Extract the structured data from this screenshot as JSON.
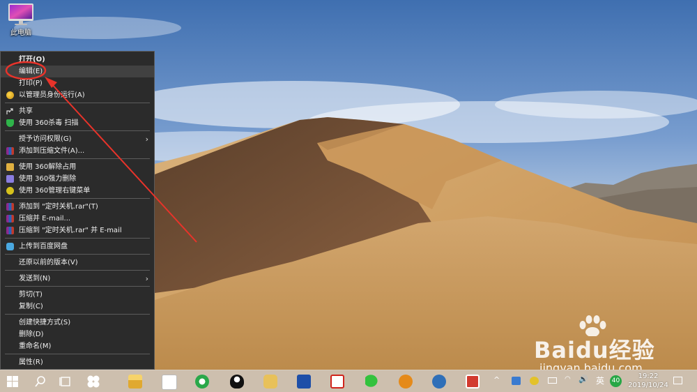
{
  "desktop": {
    "icons": [
      {
        "label": "此电脑",
        "icon": "computer-monitor-icon"
      }
    ]
  },
  "context_menu": {
    "items": [
      {
        "label": "打开(O)",
        "bold": true
      },
      {
        "label": "编辑(E)",
        "highlighted": true
      },
      {
        "label": "打印(P)"
      },
      {
        "label": "以管理员身份运行(A)",
        "icon": "run-as-admin-icon"
      },
      {
        "label": "共享",
        "icon": "share-icon"
      },
      {
        "label": "使用 360杀毒 扫描",
        "icon": "360-shield-icon"
      },
      {
        "label": "授予访问权限(G)",
        "submenu": true
      },
      {
        "label": "添加到压缩文件(A)...",
        "icon": "winrar-icon"
      },
      {
        "label": "使用 360解除占用",
        "icon": "360-unlock-icon"
      },
      {
        "label": "使用 360强力删除",
        "icon": "360-delete-icon"
      },
      {
        "label": "使用 360管理右键菜单",
        "icon": "360-menu-icon"
      },
      {
        "label": "添加到 \"定时关机.rar\"(T)",
        "icon": "winrar-icon"
      },
      {
        "label": "压缩并 E-mail...",
        "icon": "winrar-icon"
      },
      {
        "label": "压缩到 \"定时关机.rar\" 并 E-mail",
        "icon": "winrar-icon"
      },
      {
        "label": "上传到百度网盘",
        "icon": "baidu-netdisk-icon"
      },
      {
        "label": "还原以前的版本(V)"
      },
      {
        "label": "发送到(N)",
        "submenu": true
      },
      {
        "label": "剪切(T)"
      },
      {
        "label": "复制(C)"
      },
      {
        "label": "创建快捷方式(S)"
      },
      {
        "label": "删除(D)"
      },
      {
        "label": "重命名(M)"
      },
      {
        "label": "属性(R)"
      }
    ],
    "submenu_arrow": "›"
  },
  "watermark": {
    "brand": "Baidu经验",
    "url": "jingyan.baidu.com"
  },
  "taskbar": {
    "apps": [
      "start-icon",
      "search-icon",
      "task-view-icon",
      "pinwheel-icon",
      "file-explorer-icon",
      "store-icon",
      "ie-browser-icon",
      "qq-icon",
      "yuanbao-icon",
      "app-icon-tools",
      "app-icon-red",
      "wechat-icon",
      "keyhole-icon",
      "avatar-app-icon",
      "power-app-icon"
    ],
    "tray": {
      "chevron": "^",
      "volume": "🔊",
      "ime": "英",
      "badge": "40",
      "time": "19:22",
      "date": "2019/10/24"
    }
  },
  "colors": {
    "menu_bg": "#2b2b2b",
    "menu_highlight": "#414141",
    "annotation_red": "#e8332a",
    "taskbar_bg": "#cdbfae"
  }
}
